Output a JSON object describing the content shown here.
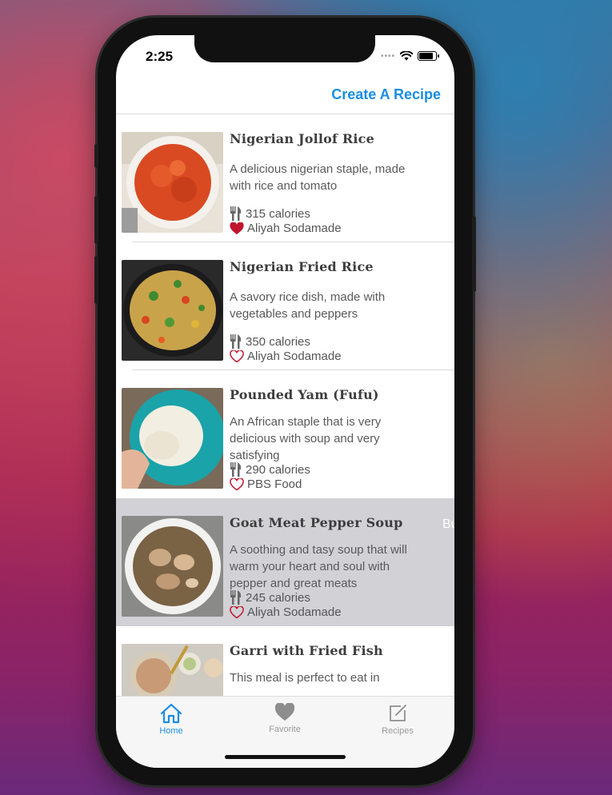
{
  "status_bar": {
    "time": "2:25"
  },
  "nav": {
    "create_label": "Create A Recipe"
  },
  "recipes": [
    {
      "title": "Nigerian Jollof Rice",
      "description": "A delicious nigerian staple, made with rice and tomato",
      "calories": "315 calories",
      "author": "Aliyah Sodamade",
      "favorited": true
    },
    {
      "title": "Nigerian Fried Rice",
      "description": "A savory rice dish, made with vegetables and peppers",
      "calories": "350 calories",
      "author": "Aliyah Sodamade",
      "favorited": false
    },
    {
      "title": "Pounded Yam (Fufu)",
      "description": "An African staple that is very delicious with soup and very satisfying",
      "calories": "290 calories",
      "author": "PBS Food",
      "favorited": false
    },
    {
      "title": "Goat Meat Pepper Soup",
      "description": "A soothing and tasy soup that will warm your heart and soul with pepper and great meats",
      "calories": "245 calories",
      "author": "Aliyah Sodamade",
      "favorited": false,
      "swipe_action": "Bu"
    },
    {
      "title": "Garri with Fried Fish",
      "description": "This meal is perfect to eat in"
    }
  ],
  "tabs": [
    {
      "label": "Home",
      "icon": "house-icon",
      "active": true
    },
    {
      "label": "Favorite",
      "icon": "heart-icon",
      "active": false
    },
    {
      "label": "Recipes",
      "icon": "compose-icon",
      "active": false
    }
  ],
  "colors": {
    "accent": "#1a8ee0",
    "heart": "#c0142e",
    "selected_row": "#d1d1d6"
  }
}
